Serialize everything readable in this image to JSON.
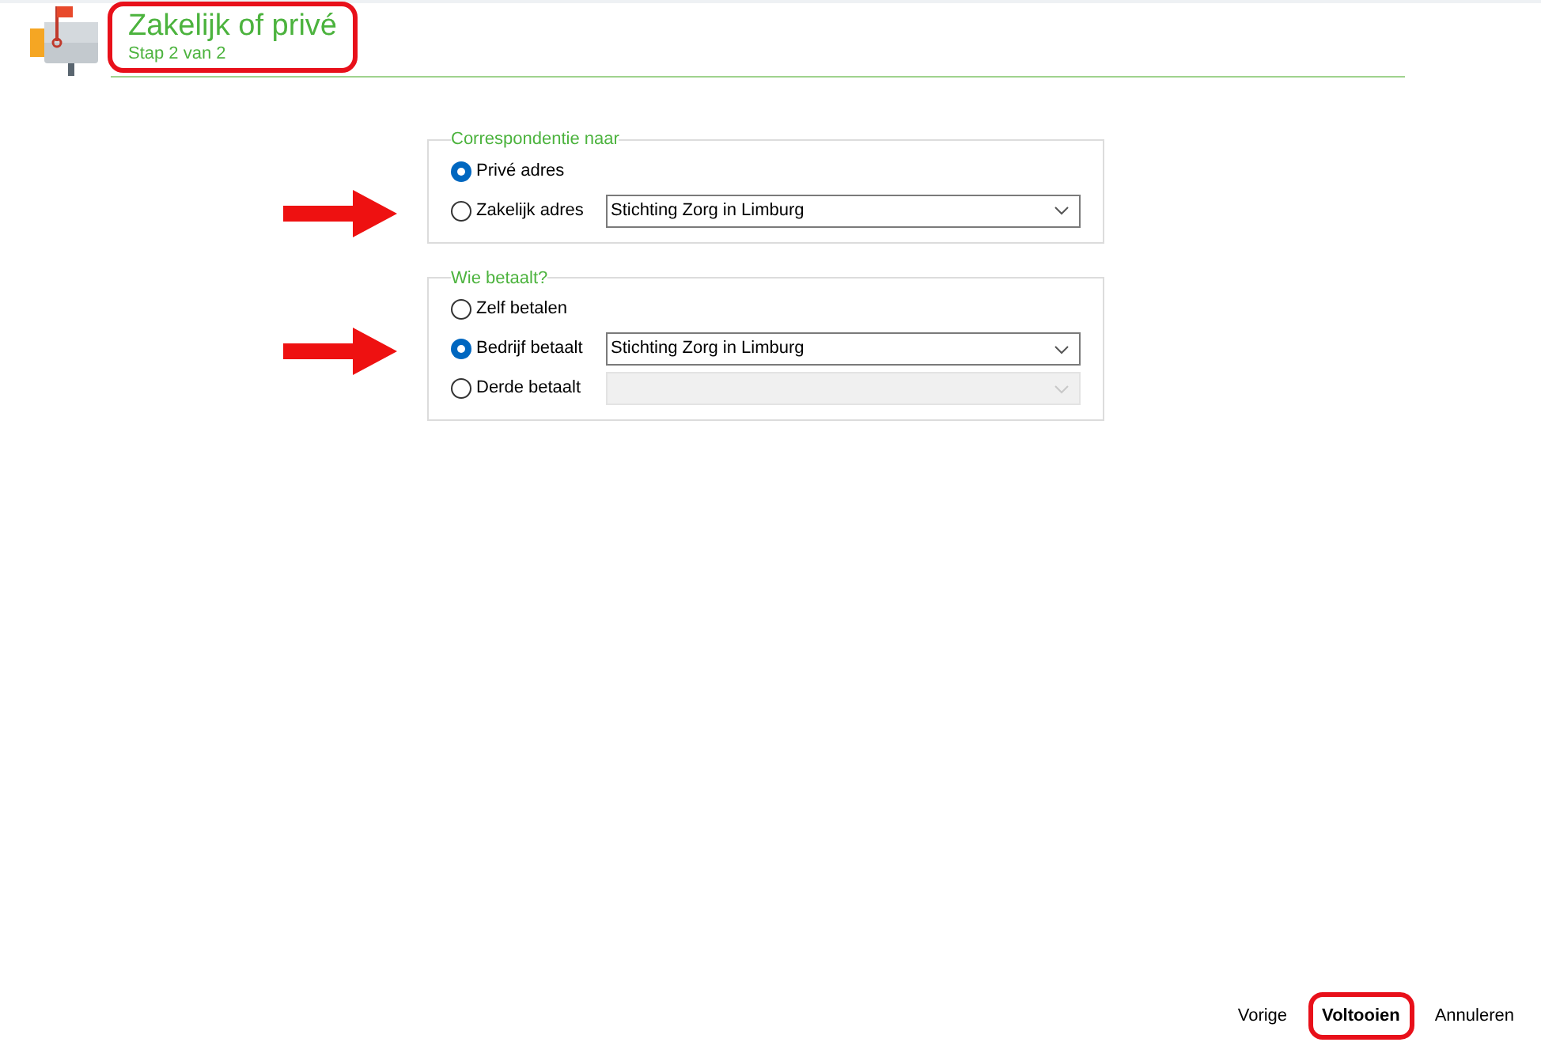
{
  "header": {
    "title": "Zakelijk of privé",
    "subtitle": "Stap 2 van 2",
    "highlighted": true
  },
  "groups": [
    {
      "legend": "Correspondentie naar",
      "options": [
        {
          "label": "Privé adres",
          "selected": true,
          "arrow": false
        },
        {
          "label": "Zakelijk adres",
          "selected": false,
          "arrow": true,
          "dropdown": {
            "value": "Stichting Zorg in Limburg",
            "disabled": false
          }
        }
      ]
    },
    {
      "legend": "Wie betaalt?",
      "options": [
        {
          "label": "Zelf betalen",
          "selected": false,
          "arrow": false
        },
        {
          "label": "Bedrijf betaalt",
          "selected": true,
          "arrow": true,
          "dropdown": {
            "value": "Stichting Zorg in Limburg",
            "disabled": false
          }
        },
        {
          "label": "Derde betaalt",
          "selected": false,
          "arrow": false,
          "dropdown": {
            "disabled": true
          }
        }
      ]
    }
  ],
  "buttons": [
    {
      "label": "Vorige",
      "primary": false,
      "highlighted": false
    },
    {
      "label": "Voltooien",
      "primary": true,
      "highlighted": true
    },
    {
      "label": "Annuleren",
      "primary": false,
      "highlighted": false
    }
  ]
}
